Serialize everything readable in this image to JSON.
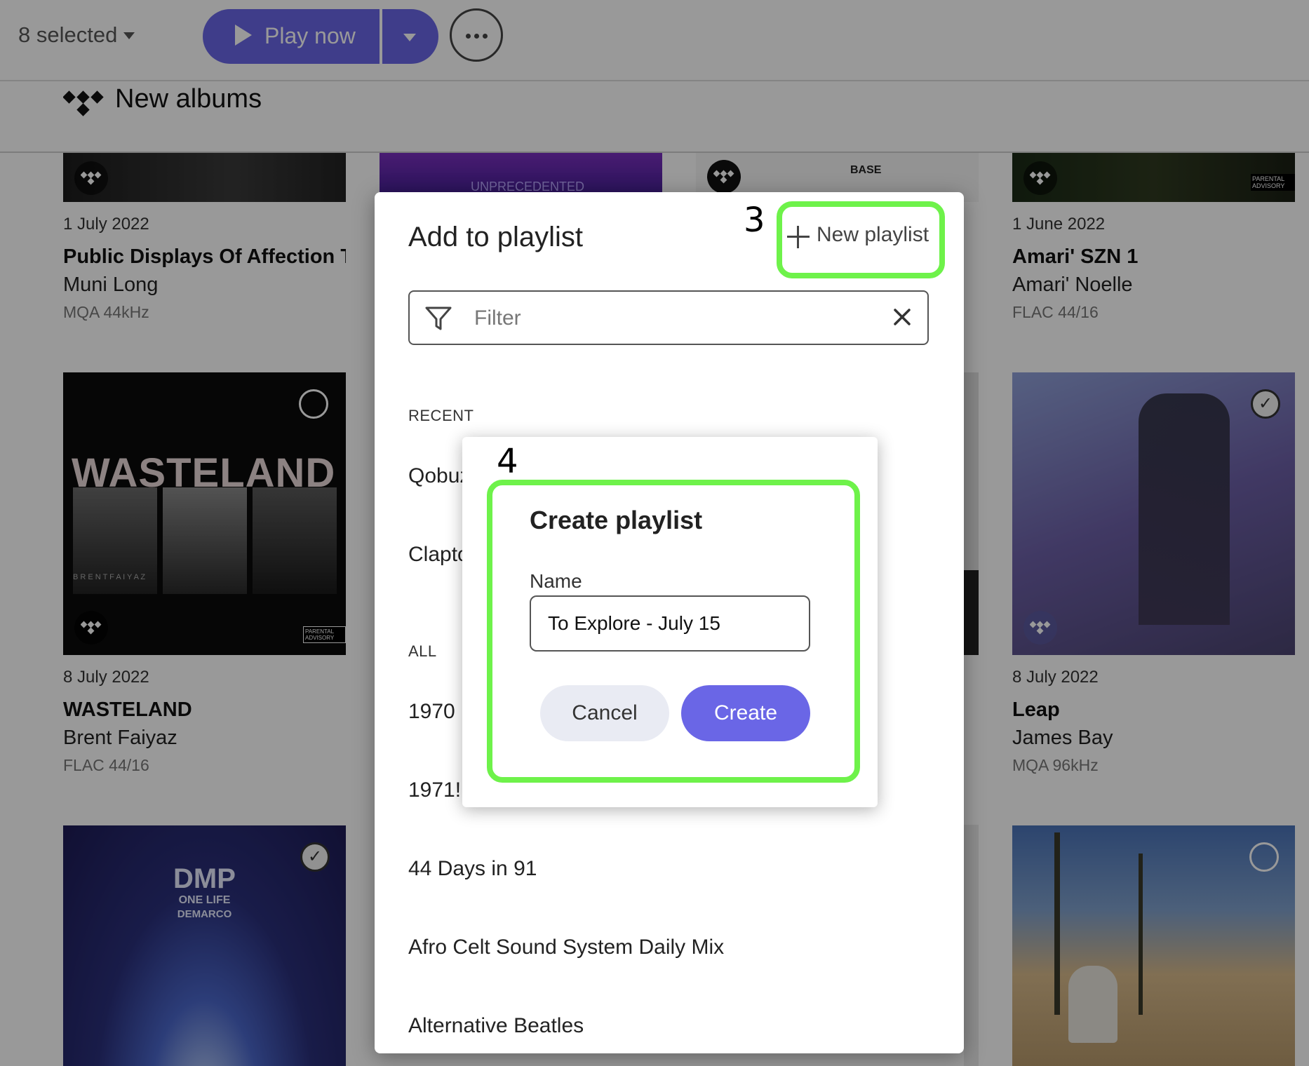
{
  "topbar": {
    "selection_label": "8 selected",
    "play_now_label": "Play now",
    "more_icon": "ellipsis-icon"
  },
  "section": {
    "title": "New albums",
    "logo": "tidal-logo"
  },
  "albums": [
    {
      "date": "1 July 2022",
      "title": "Public Displays Of Affection Too",
      "artist": "Muni Long",
      "quality": "MQA 44kHz"
    },
    {
      "date": "1 June 2022",
      "title": "Amari' SZN 1",
      "artist": "Amari' Noelle",
      "quality": "FLAC 44/16"
    },
    {
      "date": "8 July 2022",
      "title": "WASTELAND",
      "artist": "Brent Faiyaz",
      "quality": "FLAC 44/16",
      "cover_text": "WASTELAND",
      "cover_subtext": "B R E N T   F A I Y A Z",
      "selected": false
    },
    {
      "date": "8 July 2022",
      "title": "Leap",
      "artist": "James Bay",
      "quality": "MQA 96kHz",
      "selected": true
    },
    {
      "cover_text_1": "DMP",
      "cover_text_2": "ONE LIFE",
      "cover_text_3": "DEMARCO",
      "selected": true
    },
    {
      "selected": false
    }
  ],
  "cover_labels": {
    "advisory": "PARENTAL ADVISORY",
    "unprecedented": "UNPRECEDENTED",
    "base": "BASE"
  },
  "add_dialog": {
    "title": "Add to playlist",
    "new_playlist_label": "New playlist",
    "filter_placeholder": "Filter",
    "recent_header": "RECENT",
    "recent": [
      "Qobuz",
      "Clapton"
    ],
    "all_header": "ALL",
    "all": [
      "1970",
      "1971!",
      "44 Days in 91",
      "Afro Celt Sound System Daily Mix",
      "Alternative Beatles"
    ]
  },
  "create_dialog": {
    "title": "Create playlist",
    "name_label": "Name",
    "name_value": "To Explore - July 15",
    "cancel_label": "Cancel",
    "create_label": "Create"
  },
  "annotations": {
    "step_new_playlist": "3",
    "step_create": "4"
  },
  "colors": {
    "accent": "#6a66e6",
    "highlight": "#6ef24a",
    "overlay": "rgba(0,0,0,0.4)"
  }
}
